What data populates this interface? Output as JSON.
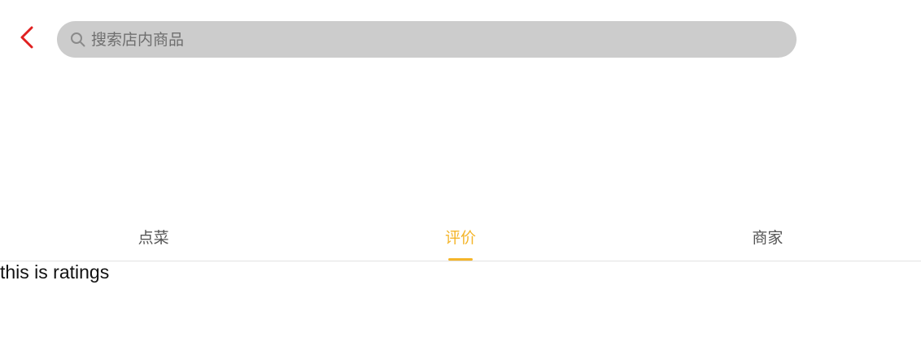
{
  "header": {
    "back_icon": "chevron-left-icon",
    "back_color": "#e02020",
    "search": {
      "icon": "search-icon",
      "placeholder": "搜索店内商品",
      "value": ""
    }
  },
  "tabs": [
    {
      "label": "点菜",
      "active": false
    },
    {
      "label": "评价",
      "active": true
    },
    {
      "label": "商家",
      "active": false
    }
  ],
  "colors": {
    "accent": "#f4b52a",
    "search_bg": "#cccccc",
    "divider": "#e2e2e2"
  },
  "content": {
    "text": "this is ratings"
  }
}
